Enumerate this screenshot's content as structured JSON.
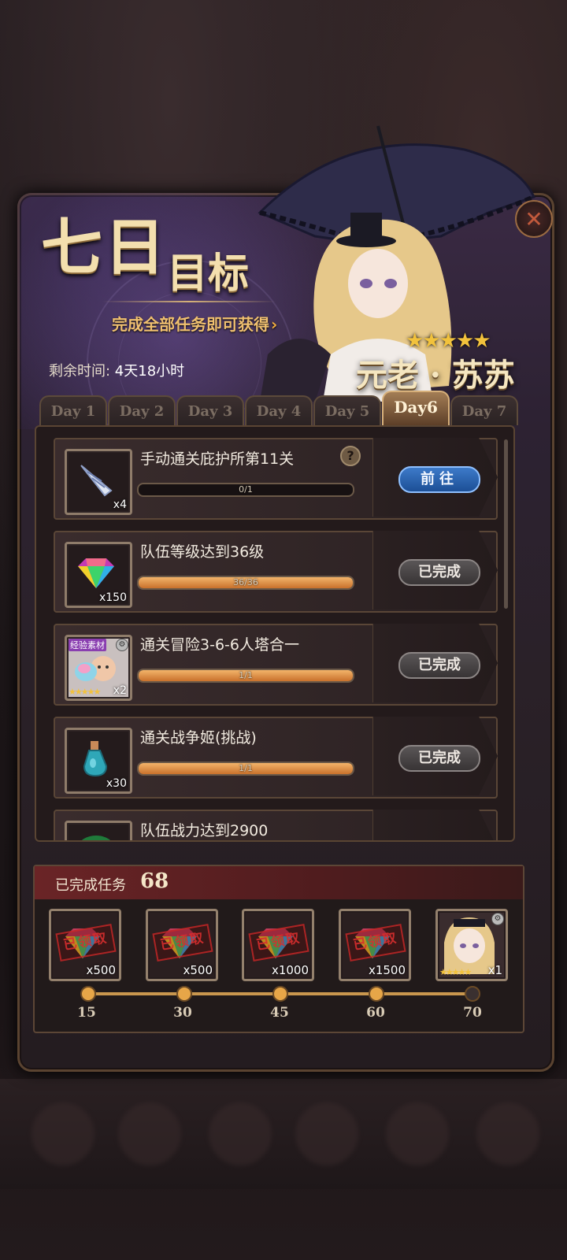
{
  "event": {
    "title_big": "七日",
    "title_small": "目标",
    "subtitle": "完成全部任务即可获得",
    "countdown_label": "剩余时间: ",
    "countdown_value": "4天18小时",
    "character_name": "元老 · 苏苏",
    "character_stars": "★★★★★"
  },
  "tabs": [
    {
      "label": "Day 1",
      "active": false
    },
    {
      "label": "Day 2",
      "active": false
    },
    {
      "label": "Day 3",
      "active": false
    },
    {
      "label": "Day 4",
      "active": false
    },
    {
      "label": "Day 5",
      "active": false
    },
    {
      "label": "Day6",
      "active": true
    },
    {
      "label": "Day 7",
      "active": false
    }
  ],
  "tasks": [
    {
      "title": "手动通关庇护所第11关",
      "item_count": "x4",
      "progress_text": "0/1",
      "progress": 0,
      "button": "前往",
      "button_state": "go",
      "has_help": true,
      "item_icon": "unicorn-horn-icon"
    },
    {
      "title": "队伍等级达到36级",
      "item_count": "x150",
      "progress_text": "36/36",
      "progress": 1,
      "button": "已完成",
      "button_state": "done",
      "has_help": false,
      "item_icon": "rainbow-gem-icon"
    },
    {
      "title": "通关冒险3-6-6人塔合一",
      "item_count": "x2",
      "progress_text": "1/1",
      "progress": 1,
      "button": "已完成",
      "button_state": "done",
      "has_help": false,
      "item_icon": "exp-material-icon",
      "item_badge": "经验素材",
      "item_stars": "★★★★★"
    },
    {
      "title": "通关战争姬(挑战)",
      "item_count": "x30",
      "progress_text": "1/1",
      "progress": 1,
      "button": "已完成",
      "button_state": "done",
      "has_help": false,
      "item_icon": "potion-bottle-icon"
    },
    {
      "title": "队伍战力达到2900",
      "item_count": "",
      "progress_text": "",
      "progress": 0,
      "button": "",
      "button_state": "partial",
      "has_help": false,
      "item_icon": "green-item-icon"
    }
  ],
  "completed": {
    "label": "已完成任务",
    "count": "68"
  },
  "rewards": [
    {
      "count": "x500",
      "claimed_stamp": "已领取",
      "milestone": "15",
      "reached": true,
      "icon": "rainbow-gem-icon"
    },
    {
      "count": "x500",
      "claimed_stamp": "已领取",
      "milestone": "30",
      "reached": true,
      "icon": "rainbow-gem-icon"
    },
    {
      "count": "x1000",
      "claimed_stamp": "已领取",
      "milestone": "45",
      "reached": true,
      "icon": "rainbow-gem-icon"
    },
    {
      "count": "x1500",
      "claimed_stamp": "已领取",
      "milestone": "60",
      "reached": true,
      "icon": "rainbow-gem-icon"
    },
    {
      "count": "x1",
      "claimed_stamp": "",
      "milestone": "70",
      "reached": false,
      "icon": "character-portrait-icon",
      "stars": "★★★★★"
    }
  ],
  "colors": {
    "accent_gold": "#f3dfae",
    "progress_fill": "#e39a4c",
    "go_button": "#2a64b0",
    "done_button": "#4a4546",
    "header_red": "#6a2426"
  }
}
